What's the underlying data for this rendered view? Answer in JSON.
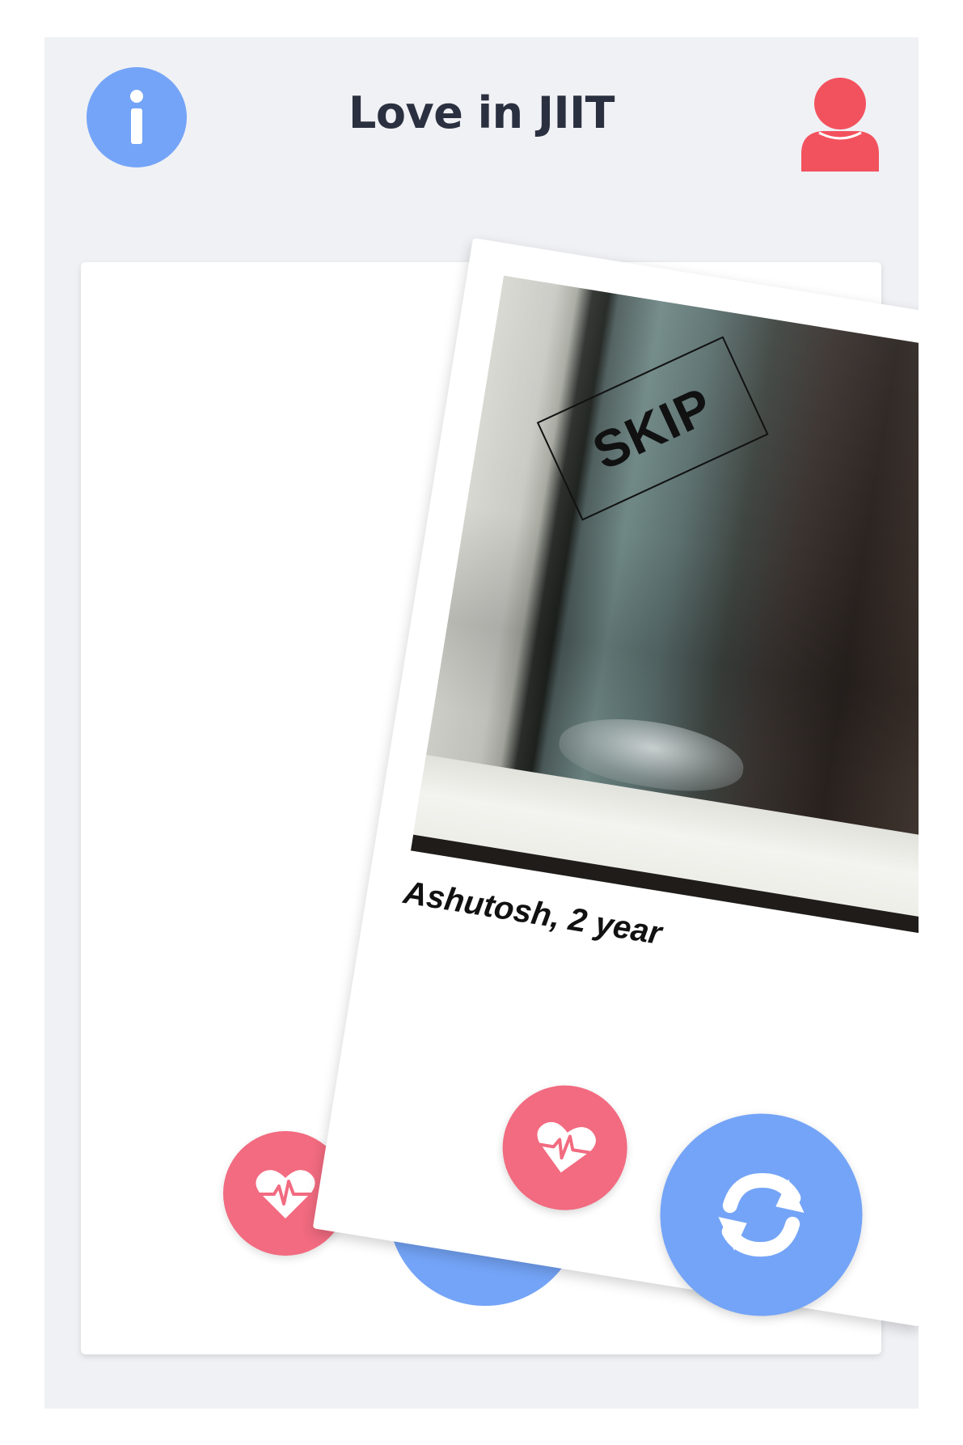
{
  "header": {
    "title": "Love in JIIT",
    "info_icon": "info-icon",
    "profile_icon": "user-icon"
  },
  "back_card": {
    "like_icon": "heart-pulse-icon",
    "refresh_icon": "refresh-icon"
  },
  "front_card": {
    "stamp": "SKIP",
    "name": "Ashutosh, 2 year",
    "like_icon": "heart-pulse-icon",
    "refresh_icon": "refresh-icon"
  },
  "colors": {
    "accent_blue": "#74a4f7",
    "like_pink": "#f26b80",
    "profile_red": "#f2525e",
    "background": "#f0f1f5",
    "title_text": "#2b3040"
  }
}
